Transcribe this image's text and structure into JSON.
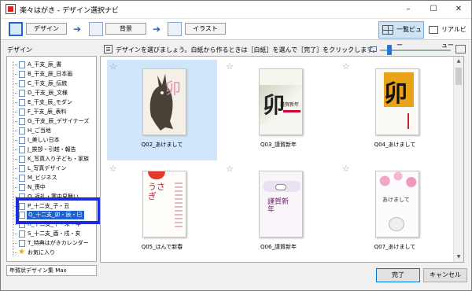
{
  "window": {
    "title": "楽々はがき - デザイン選択ナビ",
    "controls": [
      "–",
      "☐",
      "✕"
    ]
  },
  "toolbar": {
    "steps": [
      "デザイン",
      "背景",
      "イラスト"
    ],
    "views": [
      "一覧ビュー",
      "リアルビュー"
    ]
  },
  "left_panel": {
    "label": "デザイン",
    "items": [
      "A_干支_辰_書",
      "B_干支_辰_日本画",
      "C_干支_辰_伝統",
      "D_干支_辰_文様",
      "E_干支_辰_モダン",
      "F_干支_辰_表料",
      "G_干支_辰_デザイナーズ",
      "H_ご当地",
      "I_美しい日本",
      "J_挨拶・引越・報告",
      "K_写真入り子ども・家族",
      "L_写真デザイン",
      "M_ビジネス",
      "N_喪中",
      "O_返礼・寒中見舞い",
      "P_十二支_子・丑",
      "Q_十二支_卯・辰・巳",
      "R_十二支_午・未・申",
      "S_十二支_酉・戌・亥",
      "T_特典はがきカレンダー",
      "お気に入り"
    ],
    "selected_index": 16,
    "status": "年賀状デザイン集 Max"
  },
  "main": {
    "instruction": "デザインを選びましょう。白紙から作るときは［白紙］を選んで［完了］をクリックします。",
    "designs": [
      {
        "name": "Q02_あけまして",
        "selected": true,
        "art": "卯"
      },
      {
        "name": "Q03_謹賀新年",
        "selected": false,
        "art": "卯",
        "sub": "謹賀新年"
      },
      {
        "name": "Q04_あけまして",
        "selected": false,
        "art": "卯"
      },
      {
        "name": "Q05_ほんで新春",
        "selected": false,
        "art": "うさぎ"
      },
      {
        "name": "Q06_謹賀新年",
        "selected": false,
        "art": "謹賀新年"
      },
      {
        "name": "Q07_あけまして",
        "selected": false,
        "art": "あけまして"
      }
    ]
  },
  "footer": {
    "ok": "完了",
    "cancel": "キャンセル"
  }
}
